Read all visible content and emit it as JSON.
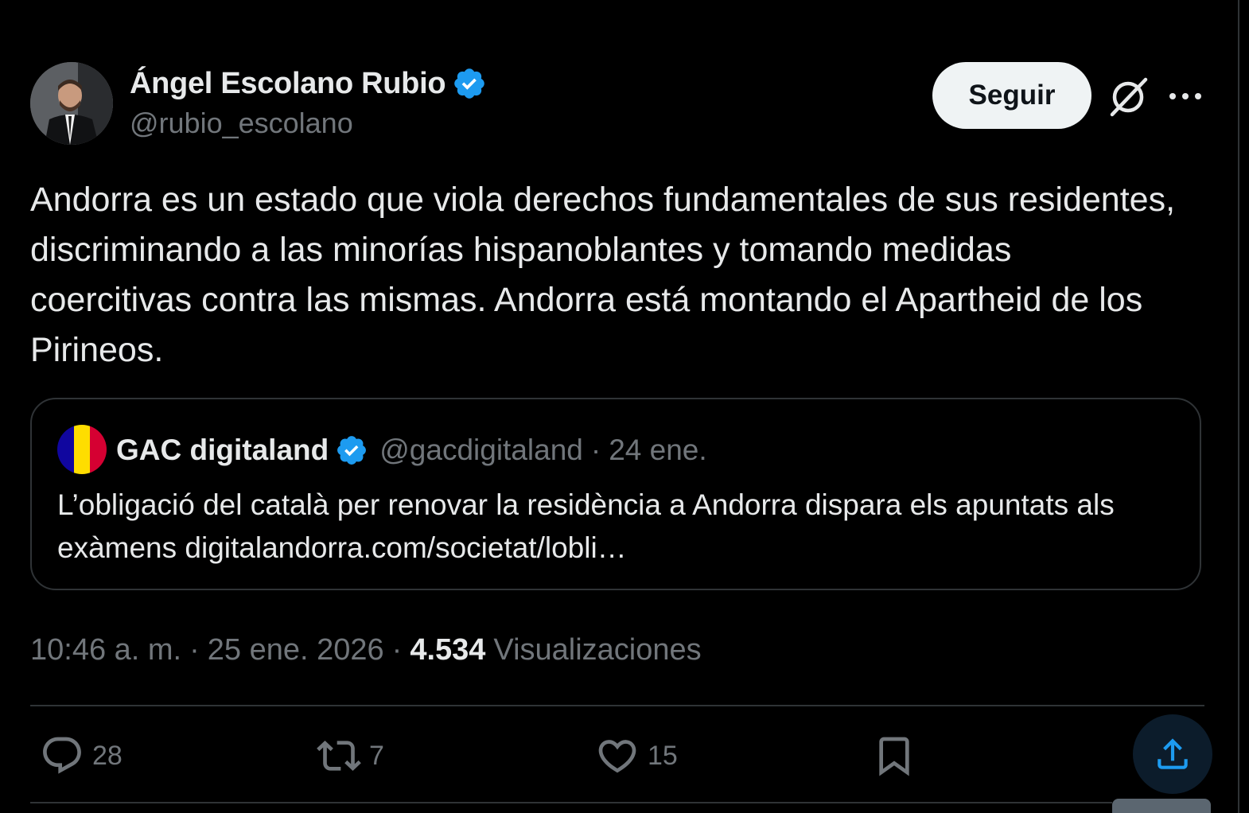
{
  "author": {
    "display_name": "Ángel Escolano Rubio",
    "handle": "@rubio_escolano",
    "verified": true
  },
  "follow_button": {
    "label": "Seguir"
  },
  "header_icons": [
    "grok-icon",
    "more-icon"
  ],
  "tweet": {
    "text": "Andorra es un estado que viola derechos fundamentales de sus residentes, discriminando a las minorías hispanoblantes y tomando medidas coercitivas contra las mismas. Andorra está montando el Apartheid de los Pirineos."
  },
  "quote": {
    "display_name": "GAC digitaland",
    "handle": "@gacdigitaland",
    "separator": "·",
    "date": "24 ene.",
    "text": "L’obligació del català per renovar la residència a Andorra dispara els apuntats als exàmens digitalandorra.com/societat/lobli…"
  },
  "meta": {
    "time": "10:46 a. m.",
    "sep1": "·",
    "date": "25 ene. 2026",
    "sep2": "·",
    "views_count": "4.534",
    "views_label": "Visualizaciones"
  },
  "actions": {
    "replies": "28",
    "reposts": "7",
    "likes": "15"
  },
  "colors": {
    "background": "#000000",
    "text_primary": "#e7e9ea",
    "text_secondary": "#71767b",
    "border": "#2f3336",
    "verified_blue": "#1d9bf0",
    "follow_bg": "#eff3f4",
    "share_bg": "#0c1c2b"
  }
}
